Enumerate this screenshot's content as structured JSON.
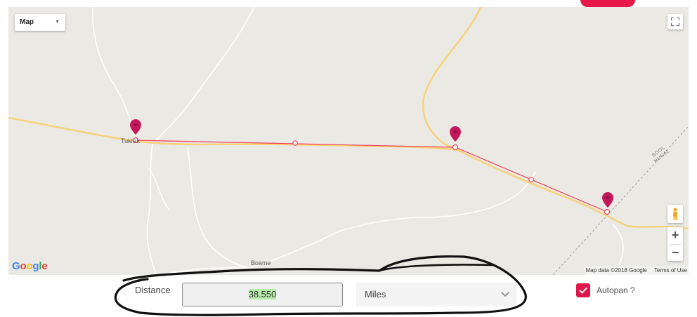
{
  "map": {
    "type_selector": "Map",
    "places": [
      {
        "name": "Tukarak",
        "label": "Tukrak"
      },
      {
        "name": "Boame",
        "label": "Boame"
      }
    ],
    "region_label": [
      "SOOL",
      "NUGAL"
    ],
    "attribution": "Map data ©2018 Google",
    "terms": "Terms of Use",
    "logo": "Google",
    "markers": [
      "waypoint-1",
      "waypoint-2",
      "waypoint-3"
    ],
    "colors": {
      "marker": "#c2185b",
      "route": "#f0405a",
      "road": "#f7d27a",
      "land": "#ebe9e4"
    }
  },
  "distance": {
    "label": "Distance",
    "value": "38.550",
    "unit": "Miles"
  },
  "autopan": {
    "label": "Autopan ?",
    "checked": true
  }
}
